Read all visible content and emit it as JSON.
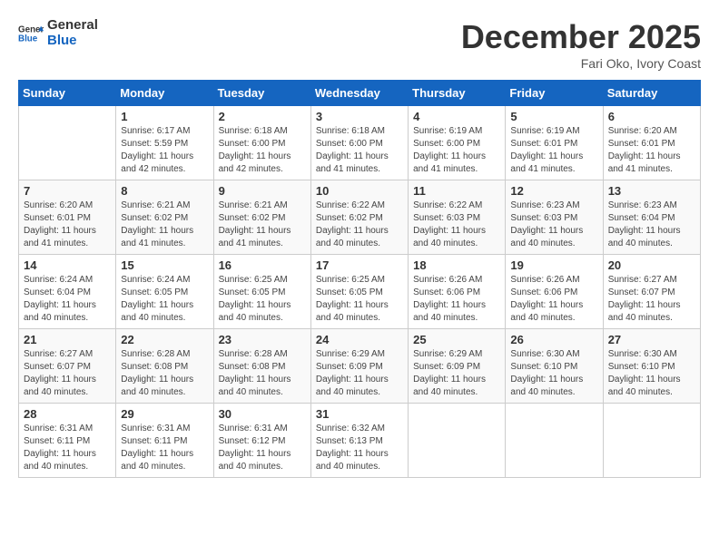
{
  "header": {
    "logo_line1": "General",
    "logo_line2": "Blue",
    "month": "December 2025",
    "location": "Fari Oko, Ivory Coast"
  },
  "days_of_week": [
    "Sunday",
    "Monday",
    "Tuesday",
    "Wednesday",
    "Thursday",
    "Friday",
    "Saturday"
  ],
  "weeks": [
    [
      {
        "day": "",
        "info": ""
      },
      {
        "day": "1",
        "info": "Sunrise: 6:17 AM\nSunset: 5:59 PM\nDaylight: 11 hours\nand 42 minutes."
      },
      {
        "day": "2",
        "info": "Sunrise: 6:18 AM\nSunset: 6:00 PM\nDaylight: 11 hours\nand 42 minutes."
      },
      {
        "day": "3",
        "info": "Sunrise: 6:18 AM\nSunset: 6:00 PM\nDaylight: 11 hours\nand 41 minutes."
      },
      {
        "day": "4",
        "info": "Sunrise: 6:19 AM\nSunset: 6:00 PM\nDaylight: 11 hours\nand 41 minutes."
      },
      {
        "day": "5",
        "info": "Sunrise: 6:19 AM\nSunset: 6:01 PM\nDaylight: 11 hours\nand 41 minutes."
      },
      {
        "day": "6",
        "info": "Sunrise: 6:20 AM\nSunset: 6:01 PM\nDaylight: 11 hours\nand 41 minutes."
      }
    ],
    [
      {
        "day": "7",
        "info": "Sunrise: 6:20 AM\nSunset: 6:01 PM\nDaylight: 11 hours\nand 41 minutes."
      },
      {
        "day": "8",
        "info": "Sunrise: 6:21 AM\nSunset: 6:02 PM\nDaylight: 11 hours\nand 41 minutes."
      },
      {
        "day": "9",
        "info": "Sunrise: 6:21 AM\nSunset: 6:02 PM\nDaylight: 11 hours\nand 41 minutes."
      },
      {
        "day": "10",
        "info": "Sunrise: 6:22 AM\nSunset: 6:02 PM\nDaylight: 11 hours\nand 40 minutes."
      },
      {
        "day": "11",
        "info": "Sunrise: 6:22 AM\nSunset: 6:03 PM\nDaylight: 11 hours\nand 40 minutes."
      },
      {
        "day": "12",
        "info": "Sunrise: 6:23 AM\nSunset: 6:03 PM\nDaylight: 11 hours\nand 40 minutes."
      },
      {
        "day": "13",
        "info": "Sunrise: 6:23 AM\nSunset: 6:04 PM\nDaylight: 11 hours\nand 40 minutes."
      }
    ],
    [
      {
        "day": "14",
        "info": "Sunrise: 6:24 AM\nSunset: 6:04 PM\nDaylight: 11 hours\nand 40 minutes."
      },
      {
        "day": "15",
        "info": "Sunrise: 6:24 AM\nSunset: 6:05 PM\nDaylight: 11 hours\nand 40 minutes."
      },
      {
        "day": "16",
        "info": "Sunrise: 6:25 AM\nSunset: 6:05 PM\nDaylight: 11 hours\nand 40 minutes."
      },
      {
        "day": "17",
        "info": "Sunrise: 6:25 AM\nSunset: 6:05 PM\nDaylight: 11 hours\nand 40 minutes."
      },
      {
        "day": "18",
        "info": "Sunrise: 6:26 AM\nSunset: 6:06 PM\nDaylight: 11 hours\nand 40 minutes."
      },
      {
        "day": "19",
        "info": "Sunrise: 6:26 AM\nSunset: 6:06 PM\nDaylight: 11 hours\nand 40 minutes."
      },
      {
        "day": "20",
        "info": "Sunrise: 6:27 AM\nSunset: 6:07 PM\nDaylight: 11 hours\nand 40 minutes."
      }
    ],
    [
      {
        "day": "21",
        "info": "Sunrise: 6:27 AM\nSunset: 6:07 PM\nDaylight: 11 hours\nand 40 minutes."
      },
      {
        "day": "22",
        "info": "Sunrise: 6:28 AM\nSunset: 6:08 PM\nDaylight: 11 hours\nand 40 minutes."
      },
      {
        "day": "23",
        "info": "Sunrise: 6:28 AM\nSunset: 6:08 PM\nDaylight: 11 hours\nand 40 minutes."
      },
      {
        "day": "24",
        "info": "Sunrise: 6:29 AM\nSunset: 6:09 PM\nDaylight: 11 hours\nand 40 minutes."
      },
      {
        "day": "25",
        "info": "Sunrise: 6:29 AM\nSunset: 6:09 PM\nDaylight: 11 hours\nand 40 minutes."
      },
      {
        "day": "26",
        "info": "Sunrise: 6:30 AM\nSunset: 6:10 PM\nDaylight: 11 hours\nand 40 minutes."
      },
      {
        "day": "27",
        "info": "Sunrise: 6:30 AM\nSunset: 6:10 PM\nDaylight: 11 hours\nand 40 minutes."
      }
    ],
    [
      {
        "day": "28",
        "info": "Sunrise: 6:31 AM\nSunset: 6:11 PM\nDaylight: 11 hours\nand 40 minutes."
      },
      {
        "day": "29",
        "info": "Sunrise: 6:31 AM\nSunset: 6:11 PM\nDaylight: 11 hours\nand 40 minutes."
      },
      {
        "day": "30",
        "info": "Sunrise: 6:31 AM\nSunset: 6:12 PM\nDaylight: 11 hours\nand 40 minutes."
      },
      {
        "day": "31",
        "info": "Sunrise: 6:32 AM\nSunset: 6:13 PM\nDaylight: 11 hours\nand 40 minutes."
      },
      {
        "day": "",
        "info": ""
      },
      {
        "day": "",
        "info": ""
      },
      {
        "day": "",
        "info": ""
      }
    ]
  ]
}
